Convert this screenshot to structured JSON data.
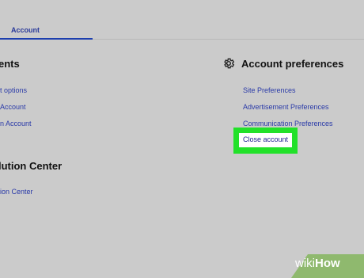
{
  "tabs": {
    "active_label": "Account"
  },
  "left_section": {
    "heading_partial": "ents",
    "links": [
      "t options",
      "Account",
      "n Account"
    ]
  },
  "resolution_section": {
    "heading_partial": "lution Center",
    "links": [
      "ion Center"
    ]
  },
  "account_preferences": {
    "icon": "gear-icon",
    "heading": "Account preferences",
    "links": [
      "Site Preferences",
      "Advertisement Preferences",
      "Communication Preferences"
    ],
    "close_account": "Close account"
  },
  "highlight_color": "#22e12a",
  "watermark": {
    "prefix": "wiki",
    "suffix": "How"
  }
}
